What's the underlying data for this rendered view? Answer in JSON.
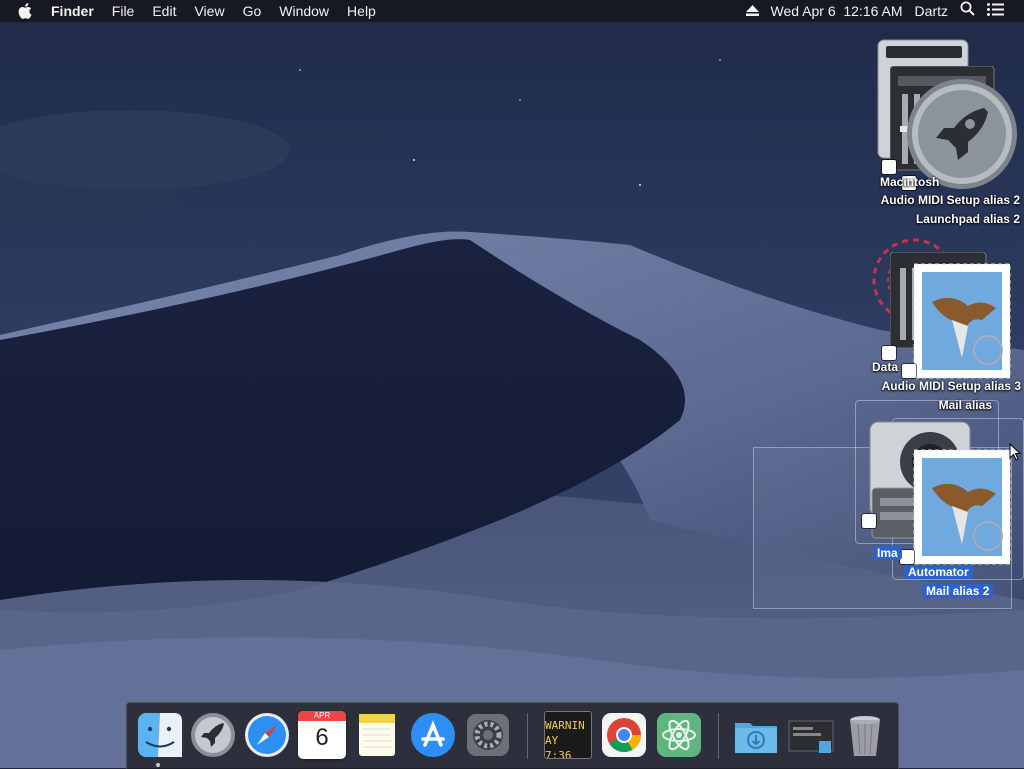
{
  "menubar": {
    "app_name": "Finder",
    "items": [
      "File",
      "Edit",
      "View",
      "Go",
      "Window",
      "Help"
    ],
    "datetime": "Wed Apr 6  12:16 AM",
    "user": "Dartz"
  },
  "desktop": {
    "icons": [
      {
        "name": "macintosh-hd",
        "label": "Macintosh"
      },
      {
        "name": "audio-midi-setup-alias-2",
        "label": "Audio MIDI Setup alias 2"
      },
      {
        "name": "launchpad-alias-2",
        "label": "Launchpad alias 2"
      },
      {
        "name": "data-disk",
        "label": "Data"
      },
      {
        "name": "audio-midi-setup-alias-3",
        "label": "Audio MIDI Setup alias 3"
      },
      {
        "name": "mail-alias",
        "label": "Mail alias"
      },
      {
        "name": "image-capture",
        "label": "Ima"
      },
      {
        "name": "automator",
        "label": "Automator"
      },
      {
        "name": "mail-alias-2",
        "label": "Mail alias 2"
      }
    ]
  },
  "dock": {
    "apps": [
      "Finder",
      "Launchpad",
      "Safari",
      "Calendar",
      "Notes",
      "App Store",
      "System Preferences",
      "Console",
      "Google Chrome",
      "Atom",
      "Downloads",
      "Screenshot",
      "Trash"
    ],
    "calendar_month": "APR",
    "calendar_day": "6",
    "console_line1": "WARNIN",
    "console_line2": "AY 7:36"
  },
  "colors": {
    "selection": "#2b62cc",
    "menubar": "#16181e"
  }
}
